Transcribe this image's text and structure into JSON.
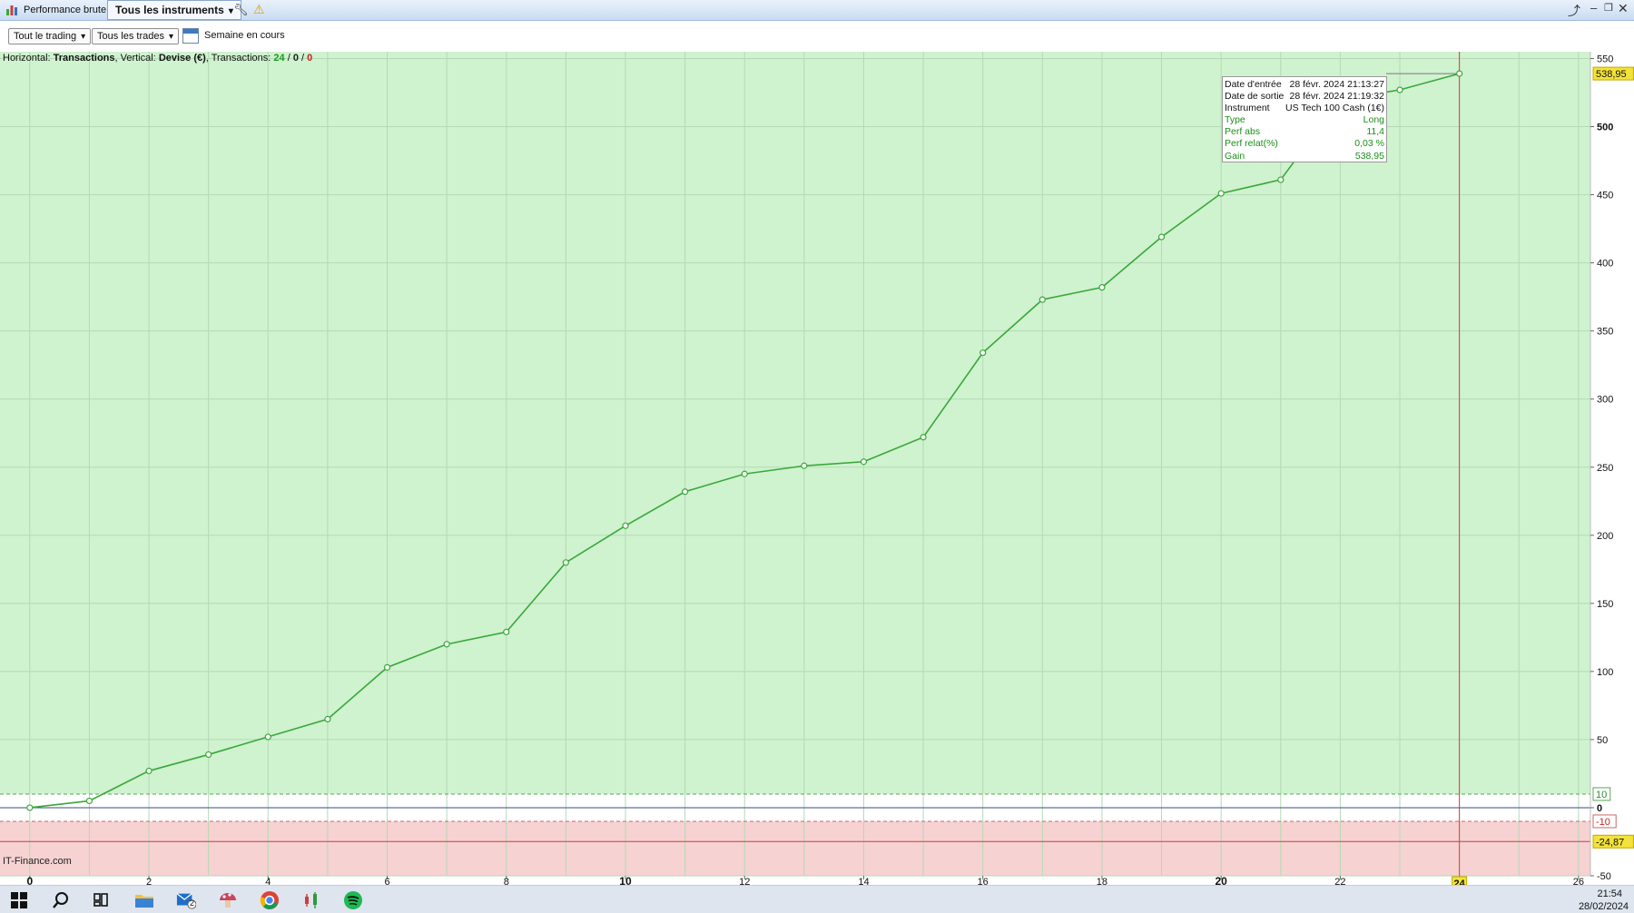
{
  "titlebar": {
    "tab_performance": "Performance brute",
    "tab_instruments": "Tous les instruments"
  },
  "toolbar": {
    "trading_filter": "Tout le trading",
    "trades_filter": "Tous les trades",
    "period": "Semaine en cours"
  },
  "header": {
    "horizontal_label": "Horizontal:",
    "horizontal_value": "Transactions",
    "vertical_label": ", Vertical:",
    "vertical_value": "Devise (€)",
    "transactions_label": ", Transactions:",
    "tx_total": "24",
    "tx_zero": "0",
    "tx_loss": "0",
    "sep": " / "
  },
  "watermark": "IT-Finance.com",
  "tooltip": {
    "rows": [
      {
        "label": "Date d'entrée",
        "value": "28 févr. 2024 21:13:27"
      },
      {
        "label": "Date de sortie",
        "value": "28 févr. 2024 21:19:32"
      },
      {
        "label": "Instrument",
        "value": "US Tech 100 Cash (1€)"
      },
      {
        "label": "Type",
        "value": "Long"
      },
      {
        "label": "Perf abs",
        "value": "11,4"
      },
      {
        "label": "Perf relat(%)",
        "value": "0,03 %"
      },
      {
        "label": "Gain",
        "value": "538,95"
      }
    ]
  },
  "chart_data": {
    "type": "line",
    "xlabel": "Transactions",
    "ylabel": "Devise (€)",
    "xlim": [
      -0.5,
      26.2
    ],
    "ylim": [
      -50,
      555
    ],
    "x_ticks": [
      0,
      2,
      4,
      6,
      8,
      10,
      12,
      14,
      16,
      18,
      20,
      22,
      24,
      26
    ],
    "x_tick_labels": [
      "0",
      "2",
      "4",
      "6",
      "8",
      "10",
      "12",
      "14",
      "16",
      "18",
      "20",
      "22",
      "24",
      "26"
    ],
    "x_bold_ticks": [
      0,
      10,
      20
    ],
    "y_ticks": [
      -50,
      0,
      50,
      100,
      150,
      200,
      250,
      300,
      350,
      400,
      450,
      500,
      550
    ],
    "y_tick_labels": [
      "-50",
      "0",
      "50",
      "100",
      "150",
      "200",
      "250",
      "300",
      "350",
      "400",
      "450",
      "500",
      "550"
    ],
    "grid": true,
    "series": [
      {
        "color": "#3aa83a",
        "x": [
          0,
          1,
          2,
          3,
          4,
          5,
          6,
          7,
          8,
          9,
          10,
          11,
          12,
          13,
          14,
          15,
          16,
          17,
          18,
          19,
          20,
          21,
          22,
          23,
          24
        ],
        "y": [
          0,
          5,
          27,
          39,
          52,
          65,
          103,
          120,
          129,
          180,
          207,
          232,
          245,
          251,
          254,
          272,
          334,
          373,
          382,
          419,
          451,
          461,
          520,
          527,
          538.95
        ]
      }
    ],
    "thresholds": {
      "upper_dashed": 10,
      "lower_dashed": -10,
      "lower_solid": -24.87,
      "upper_dashed_label": "10",
      "lower_dashed_label": "-10",
      "lower_solid_label": "-24,87"
    },
    "cursor": {
      "x": 24,
      "x_label": "24",
      "y_label": "538,95"
    },
    "colors": {
      "gain_zone": "#cff2cf",
      "loss_zone": "#f6d2d2",
      "line": "#3aa83a",
      "zero_line": "#3b4a8c",
      "cursor": "#e03a3a",
      "highlight": "#f3e23a"
    }
  },
  "taskbar": {
    "icons": [
      "windows-start-icon",
      "search-icon",
      "task-view-icon",
      "file-explorer-icon",
      "mail-icon",
      "mushroom-app-icon",
      "chrome-icon",
      "trading-app-icon",
      "spotify-icon"
    ],
    "mail_badge": "2",
    "time": "21:54",
    "date": "28/02/2024"
  }
}
